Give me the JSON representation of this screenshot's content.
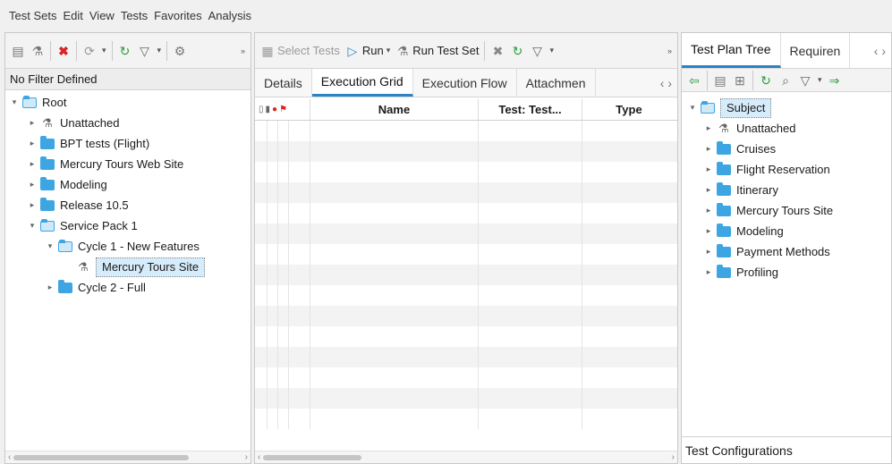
{
  "menu": [
    "Test Sets",
    "Edit",
    "View",
    "Tests",
    "Favorites",
    "Analysis"
  ],
  "left": {
    "filter_text": "No Filter Defined",
    "tree": [
      {
        "label": "Root",
        "level": 0,
        "type": "folder-open",
        "expanded": true
      },
      {
        "label": "Unattached",
        "level": 1,
        "type": "flask",
        "expanded": false
      },
      {
        "label": "BPT tests (Flight)",
        "level": 1,
        "type": "folder",
        "expanded": false
      },
      {
        "label": "Mercury Tours Web Site",
        "level": 1,
        "type": "folder",
        "expanded": false
      },
      {
        "label": "Modeling",
        "level": 1,
        "type": "folder",
        "expanded": false
      },
      {
        "label": "Release 10.5",
        "level": 1,
        "type": "folder",
        "expanded": false
      },
      {
        "label": "Service Pack 1",
        "level": 1,
        "type": "folder-open",
        "expanded": true
      },
      {
        "label": "Cycle 1 - New Features",
        "level": 2,
        "type": "folder-open",
        "expanded": true
      },
      {
        "label": "Mercury Tours Site",
        "level": 3,
        "type": "flask",
        "selected": true
      },
      {
        "label": "Cycle 2 - Full",
        "level": 2,
        "type": "folder",
        "expanded": false
      }
    ]
  },
  "middle": {
    "toolbar": {
      "select_tests": "Select Tests",
      "run": "Run",
      "run_test_set": "Run Test Set"
    },
    "tabs": [
      "Details",
      "Execution Grid",
      "Execution Flow",
      "Attachmen"
    ],
    "active_tab": "Execution Grid",
    "grid": {
      "columns": [
        "Name",
        "Test: Test...",
        "Type"
      ],
      "rows": 15
    }
  },
  "right": {
    "tabs": [
      "Test Plan Tree",
      "Requiren"
    ],
    "active_tab": "Test Plan Tree",
    "tree": [
      {
        "label": "Subject",
        "level": 0,
        "type": "folder-open",
        "expanded": true,
        "selected": true
      },
      {
        "label": "Unattached",
        "level": 1,
        "type": "flask"
      },
      {
        "label": "Cruises",
        "level": 1,
        "type": "folder"
      },
      {
        "label": "Flight Reservation",
        "level": 1,
        "type": "folder"
      },
      {
        "label": "Itinerary",
        "level": 1,
        "type": "folder"
      },
      {
        "label": "Mercury Tours Site",
        "level": 1,
        "type": "folder"
      },
      {
        "label": "Modeling",
        "level": 1,
        "type": "folder"
      },
      {
        "label": "Payment Methods",
        "level": 1,
        "type": "folder"
      },
      {
        "label": "Profiling",
        "level": 1,
        "type": "folder"
      }
    ],
    "bottom_tab": "Test Configurations"
  },
  "colors": {
    "accent": "#2a83c4",
    "folder": "#3da6e2",
    "selection": "#d6ecfb"
  }
}
